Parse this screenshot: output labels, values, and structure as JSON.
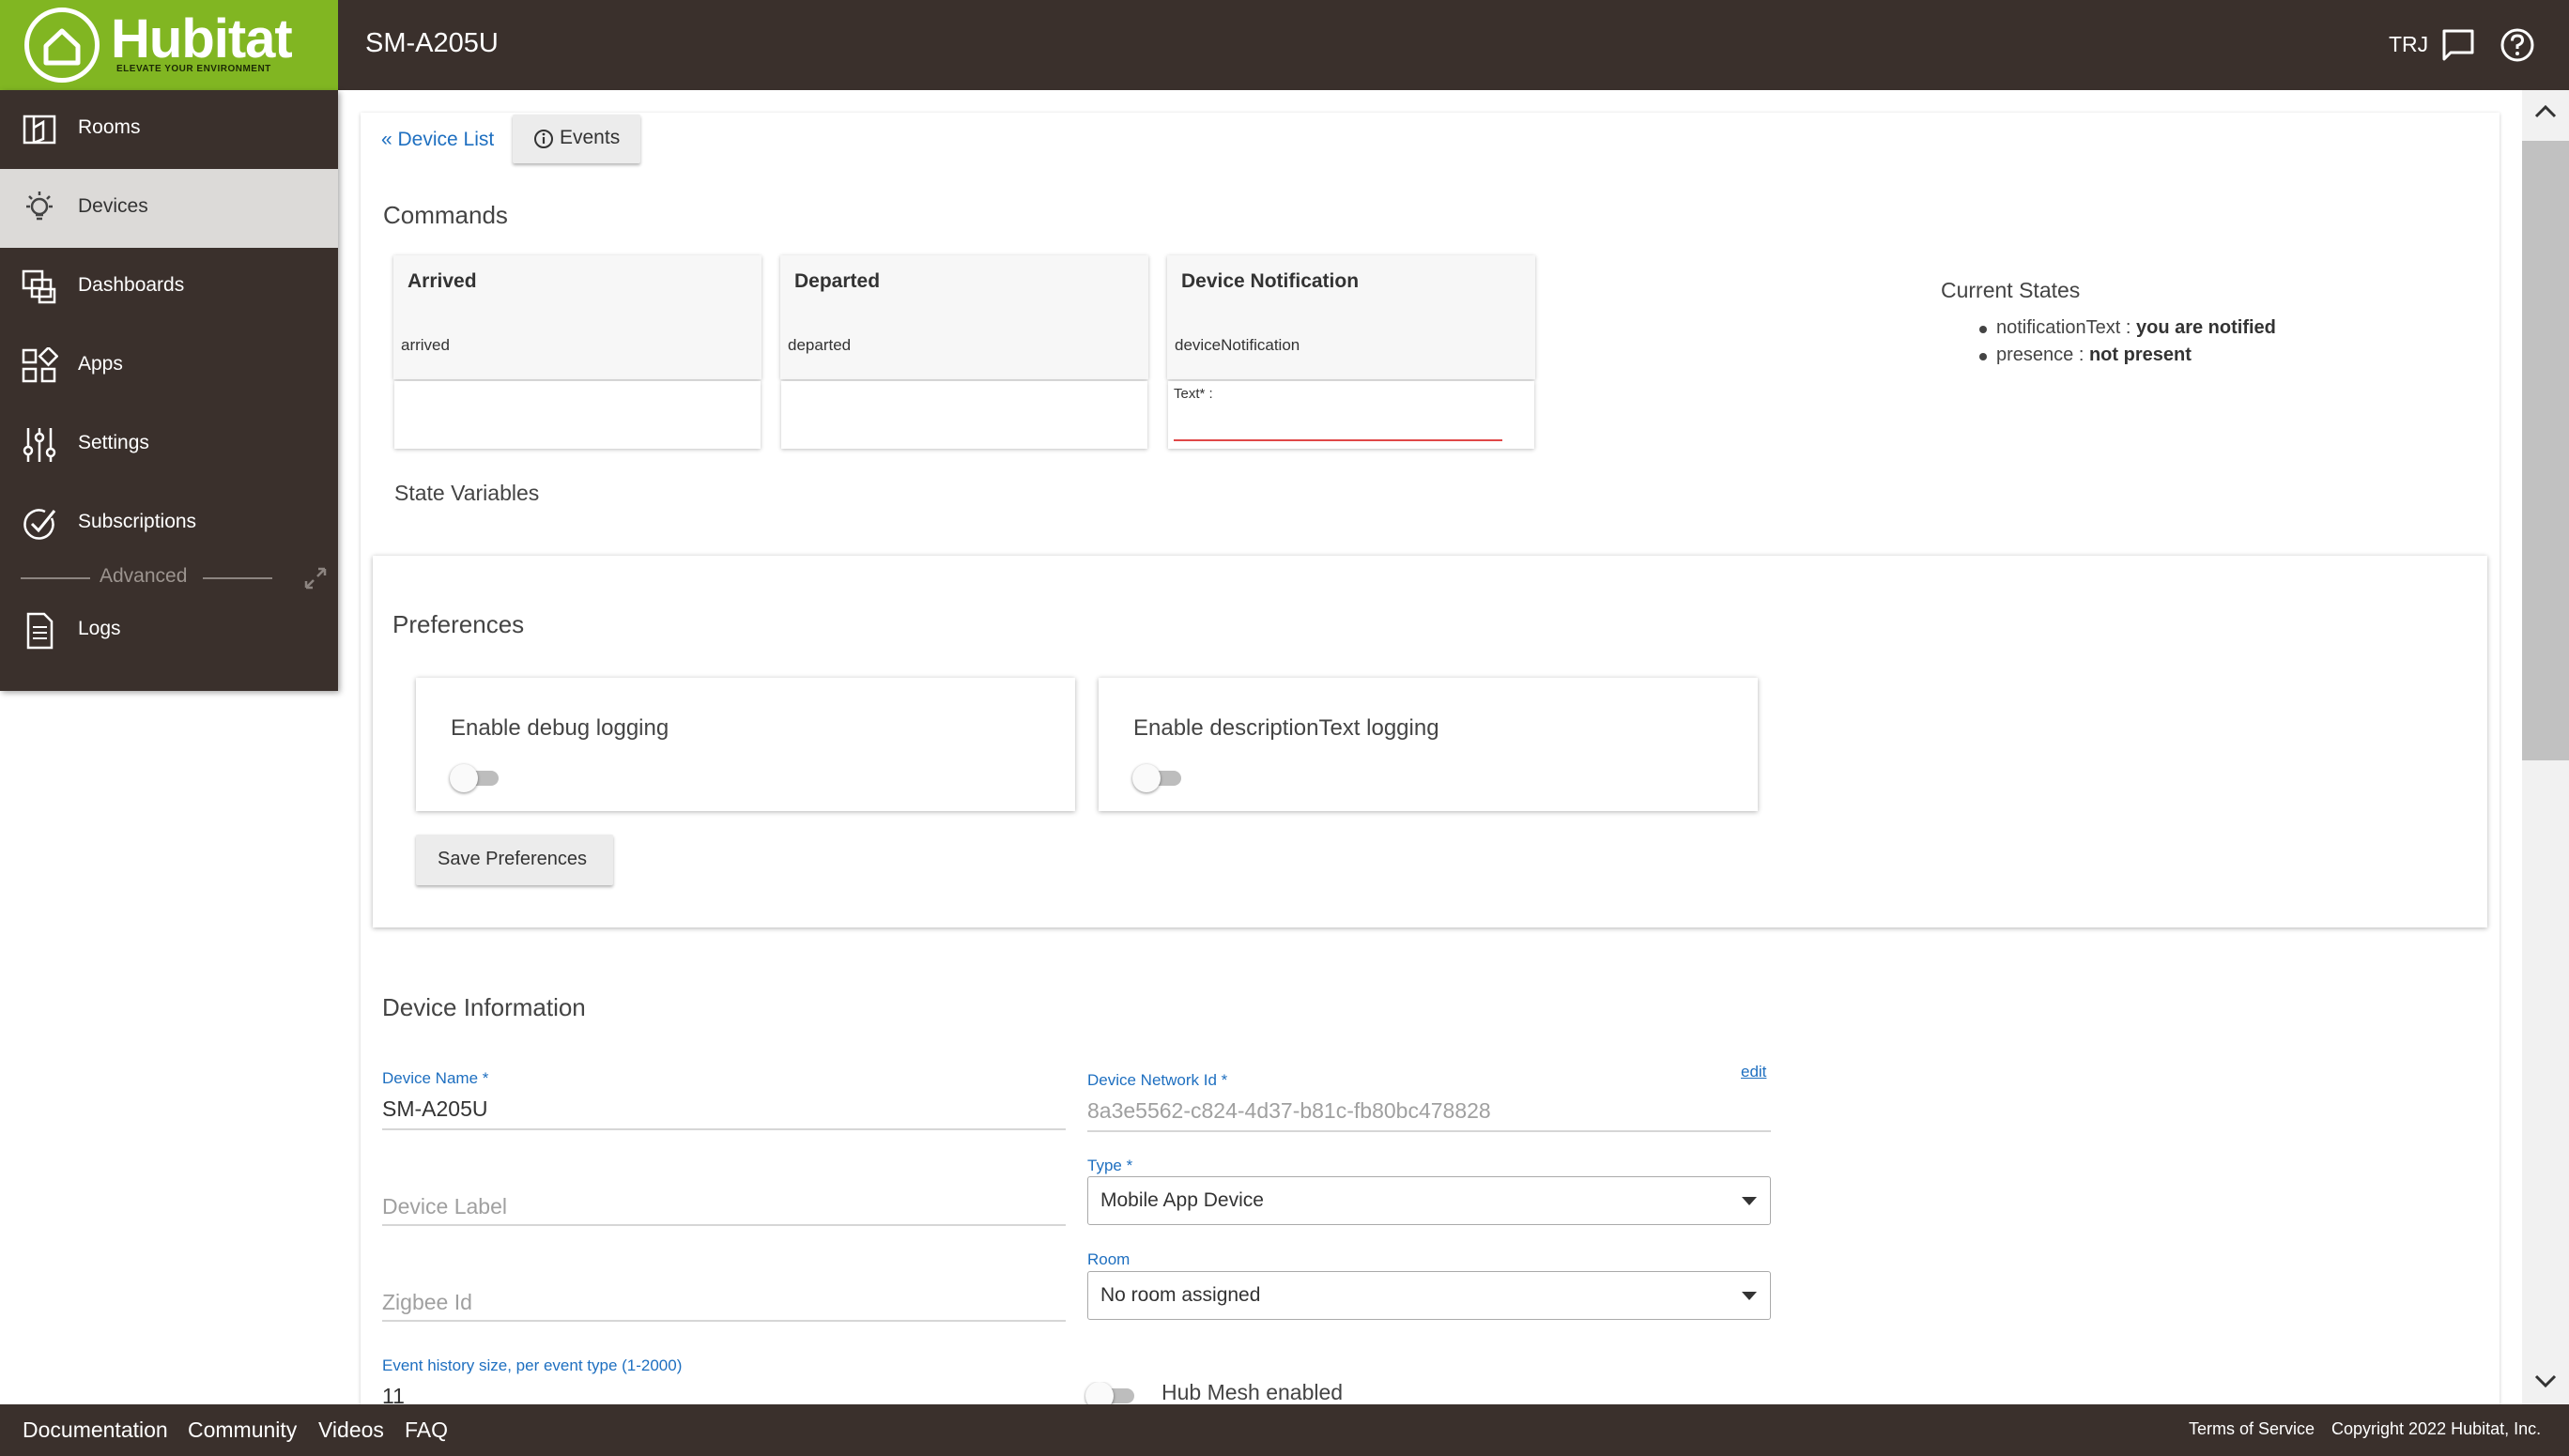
{
  "brand": {
    "name": "Hubitat",
    "tagline": "ELEVATE YOUR ENVIRONMENT",
    "color": "#81b622"
  },
  "header": {
    "title": "SM-A205U",
    "user": "TRJ",
    "icons": [
      "message-icon",
      "help-icon"
    ]
  },
  "sidebar": {
    "items": [
      {
        "label": "Rooms",
        "icon": "rooms-icon"
      },
      {
        "label": "Devices",
        "icon": "bulb-icon",
        "active": true
      },
      {
        "label": "Dashboards",
        "icon": "dashboards-icon"
      },
      {
        "label": "Apps",
        "icon": "apps-icon"
      },
      {
        "label": "Settings",
        "icon": "sliders-icon"
      },
      {
        "label": "Subscriptions",
        "icon": "check-circle-icon"
      }
    ],
    "advanced_label": "Advanced",
    "logs_label": "Logs"
  },
  "nav": {
    "back_link": "« Device List",
    "events_label": "Events"
  },
  "commands": {
    "title": "Commands",
    "cards": [
      {
        "title": "Arrived",
        "command": "arrived"
      },
      {
        "title": "Departed",
        "command": "departed"
      },
      {
        "title": "Device Notification",
        "command": "deviceNotification",
        "param_label": "Text* :"
      }
    ]
  },
  "current_states": {
    "title": "Current States",
    "items": [
      {
        "name": "notificationText :",
        "value": "you are notified"
      },
      {
        "name": "presence :",
        "value": "not present"
      }
    ]
  },
  "state_variables_title": "State Variables",
  "preferences": {
    "title": "Preferences",
    "items": [
      {
        "label": "Enable debug logging",
        "enabled": false
      },
      {
        "label": "Enable descriptionText logging",
        "enabled": false
      }
    ],
    "save_label": "Save Preferences"
  },
  "device_info": {
    "title": "Device Information",
    "name_label": "Device Name *",
    "name_value": "SM-A205U",
    "network_label": "Device Network Id *",
    "network_value": "8a3e5562-c824-4d37-b81c-fb80bc478828",
    "edit_link": "edit",
    "label_placeholder": "Device Label",
    "type_label": "Type *",
    "type_value": "Mobile App Device",
    "zigbee_placeholder": "Zigbee Id",
    "room_label": "Room",
    "room_value": "No room assigned",
    "history_label": "Event history size, per event type (1-2000)",
    "history_value": "11",
    "hub_mesh_label": "Hub Mesh enabled",
    "hub_mesh_enabled": false
  },
  "footer": {
    "links": [
      "Documentation",
      "Community",
      "Videos",
      "FAQ"
    ],
    "terms": "Terms of Service",
    "copyright": "Copyright 2022 Hubitat, Inc."
  }
}
